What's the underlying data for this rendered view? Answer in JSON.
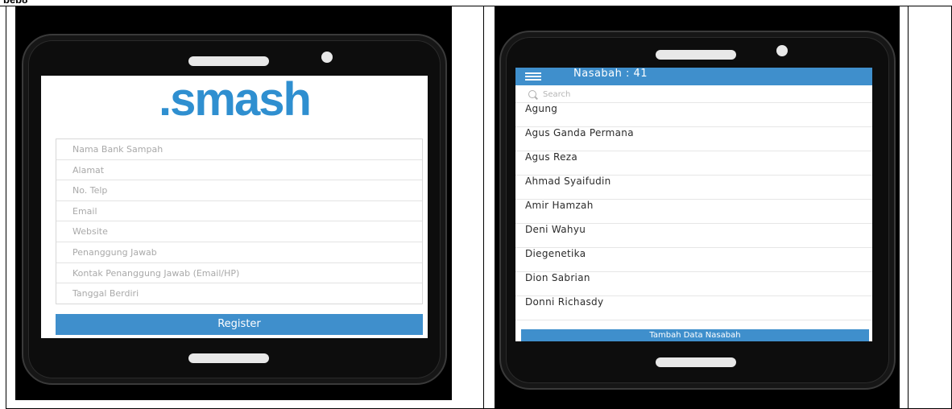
{
  "caption_fragment": "beb8",
  "register_screen": {
    "logo_text": ".smash",
    "fields": [
      {
        "placeholder": "Nama Bank Sampah"
      },
      {
        "placeholder": "Alamat"
      },
      {
        "placeholder": "No. Telp"
      },
      {
        "placeholder": "Email"
      },
      {
        "placeholder": "Website"
      },
      {
        "placeholder": "Penanggung Jawab"
      },
      {
        "placeholder": "Kontak Penanggung Jawab (Email/HP)"
      },
      {
        "placeholder": "Tanggal Berdiri"
      }
    ],
    "register_label": "Register"
  },
  "nasabah_screen": {
    "title": "Nasabah : 41",
    "search_placeholder": "Search",
    "items": [
      "Agung",
      "Agus Ganda Permana",
      "Agus Reza",
      "Ahmad Syaifudin",
      "Amir Hamzah",
      "Deni Wahyu",
      "Diegenetika",
      "Dion Sabrian",
      "Donni Richasdy"
    ],
    "add_label": "Tambah Data Nasabah"
  },
  "colors": {
    "accent": "#3f8fcc",
    "logo": "#2f8fd0",
    "phone_body": "#0d0d0d"
  }
}
